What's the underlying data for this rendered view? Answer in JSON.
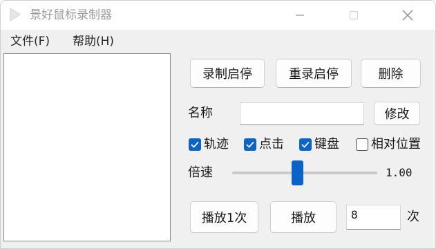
{
  "window": {
    "title": "景好鼠标录制器",
    "controls": {
      "minimize": "minimize-icon",
      "maximize": "maximize-icon",
      "close": "close-icon"
    }
  },
  "menu": {
    "file": "文件(F)",
    "help": "帮助(H)"
  },
  "buttons": {
    "record_toggle": "录制启停",
    "rerecord_toggle": "重录启停",
    "delete": "删除",
    "modify": "修改",
    "play_once": "播放1次",
    "play": "播放"
  },
  "name_field": {
    "label": "名称",
    "value": ""
  },
  "options": [
    {
      "label": "轨迹",
      "checked": true
    },
    {
      "label": "点击",
      "checked": true
    },
    {
      "label": "键盘",
      "checked": true
    },
    {
      "label": "相对位置",
      "checked": false
    }
  ],
  "speed": {
    "label": "倍速",
    "value_text": "1.00",
    "slider_fraction": 0.45
  },
  "repeat": {
    "count": "8",
    "unit": "次"
  },
  "colors": {
    "accent": "#0a64c8",
    "window_bg": "#f0f0f0"
  }
}
